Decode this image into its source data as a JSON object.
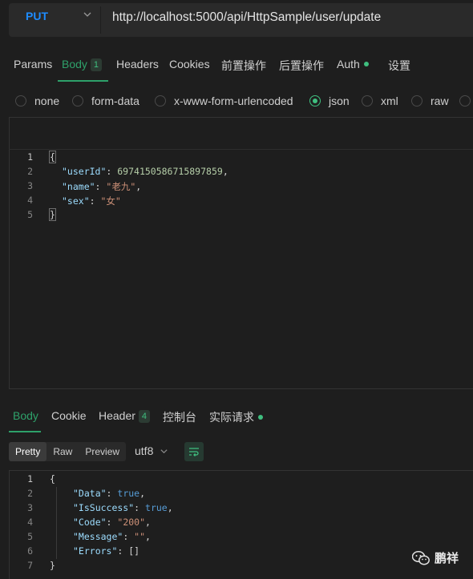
{
  "request": {
    "method": "PUT",
    "url": "http://localhost:5000/api/HttpSample/user/update"
  },
  "request_tabs": [
    {
      "label": "Params"
    },
    {
      "label": "Body",
      "badge": "1"
    },
    {
      "label": "Headers"
    },
    {
      "label": "Cookies"
    },
    {
      "label": "前置操作"
    },
    {
      "label": "后置操作"
    },
    {
      "label": "Auth"
    },
    {
      "label": "设置"
    }
  ],
  "body_types": [
    "none",
    "form-data",
    "x-www-form-urlencoded",
    "json",
    "xml",
    "raw"
  ],
  "selected_body_type": "json",
  "request_body": {
    "line_numbers": [
      "1",
      "2",
      "3",
      "4",
      "5"
    ],
    "open_brace": "{",
    "close_brace": "}",
    "fields": [
      {
        "key": "\"userId\"",
        "value": "6974150586715897859"
      },
      {
        "key": "\"name\"",
        "value": "\"老九\""
      },
      {
        "key": "\"sex\"",
        "value": "\"女\""
      }
    ]
  },
  "response_tabs": [
    {
      "label": "Body"
    },
    {
      "label": "Cookie"
    },
    {
      "label": "Header",
      "badge": "4"
    },
    {
      "label": "控制台"
    },
    {
      "label": "实际请求"
    }
  ],
  "response_view_modes": [
    "Pretty",
    "Raw",
    "Preview"
  ],
  "active_view_mode": "Pretty",
  "encoding": "utf8",
  "response_body": {
    "line_numbers": [
      "1",
      "2",
      "3",
      "4",
      "5",
      "6",
      "7"
    ],
    "open_brace": "{",
    "close_brace": "}",
    "fields": [
      {
        "key": "\"Data\"",
        "value": "true"
      },
      {
        "key": "\"IsSuccess\"",
        "value": "true"
      },
      {
        "key": "\"Code\"",
        "value": "\"200\""
      },
      {
        "key": "\"Message\"",
        "value": "\"\""
      },
      {
        "key": "\"Errors\"",
        "value": "[]"
      }
    ]
  },
  "watermark": {
    "text": "鹏祥",
    "icon": "wechat-icon"
  },
  "colors": {
    "accent": "#2ea16a",
    "method": "#1e8cff",
    "background": "#1e1e1e"
  }
}
